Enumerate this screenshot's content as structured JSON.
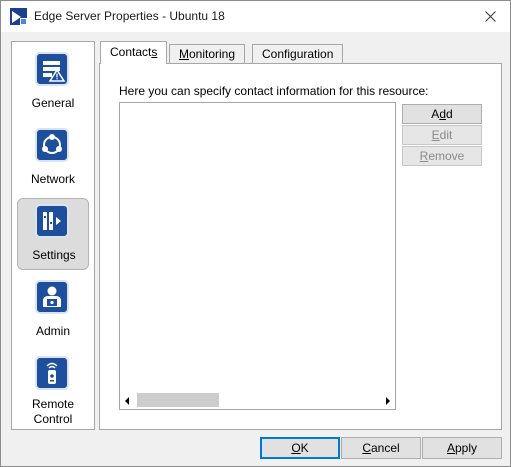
{
  "window": {
    "title": "Edge Server Properties - Ubuntu 18"
  },
  "nav": {
    "items": [
      {
        "label": "General",
        "icon": "server-warning-icon"
      },
      {
        "label": "Network",
        "icon": "network-nodes-icon"
      },
      {
        "label": "Settings",
        "icon": "settings-panel-icon",
        "selected": true
      },
      {
        "label": "Admin",
        "icon": "admin-user-icon"
      },
      {
        "label_line1": "Remote",
        "label_line2": "Control",
        "icon": "remote-control-icon"
      }
    ]
  },
  "tabs": {
    "contacts": {
      "pre": "Contact",
      "acc": "s",
      "post": ""
    },
    "monitoring": {
      "pre": "",
      "acc": "M",
      "post": "onitoring"
    },
    "configuration": {
      "pre": "",
      "acc": "",
      "post": "Configuration"
    },
    "active": "Contacts"
  },
  "contacts": {
    "hint": "Here you can specify contact information for this resource:",
    "add": {
      "pre": "A",
      "acc": "d",
      "post": "d"
    },
    "edit": {
      "pre": "",
      "acc": "E",
      "post": "dit"
    },
    "remove": {
      "pre": "",
      "acc": "R",
      "post": "emove"
    }
  },
  "footer": {
    "ok": {
      "pre": "",
      "acc": "O",
      "post": "K"
    },
    "cancel": {
      "pre": "",
      "acc": "C",
      "post": "ancel"
    },
    "apply": {
      "pre": "",
      "acc": "A",
      "post": "pply"
    }
  },
  "colors": {
    "icon_blue": "#1d4f9c",
    "selected_bg": "#dcdcdc",
    "default_button_border": "#0078d7"
  }
}
